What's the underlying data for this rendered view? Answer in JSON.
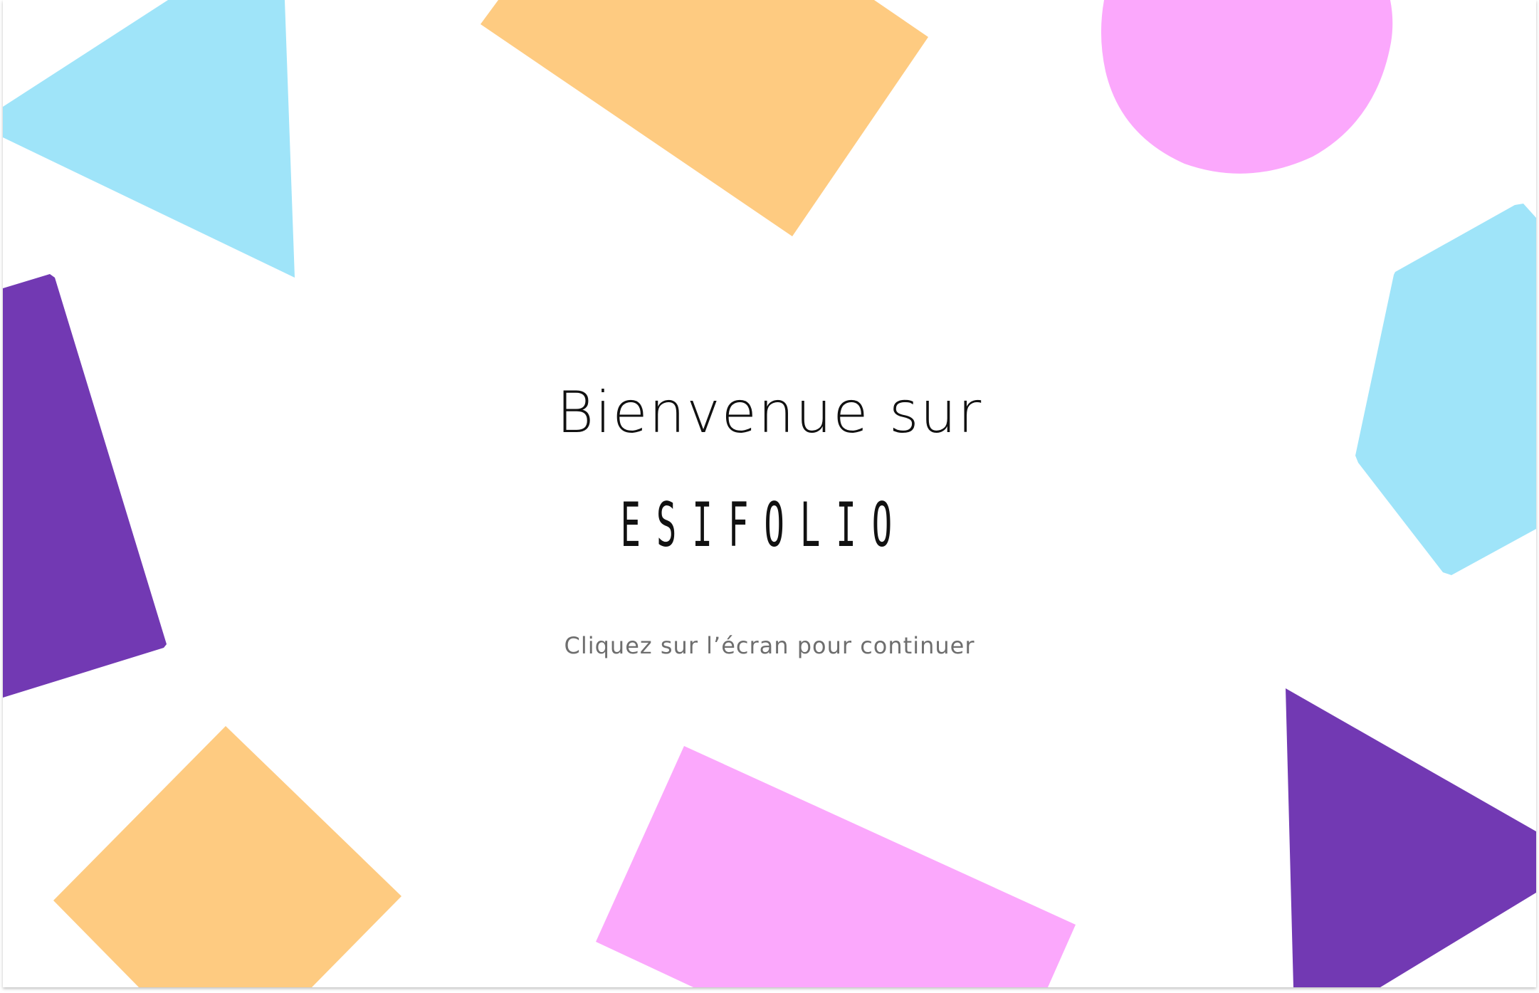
{
  "welcome": {
    "heading": "Bienvenue sur",
    "brand": "ESIFOLIO",
    "hint": "Cliquez sur l’écran pour continuer"
  },
  "colors": {
    "light_blue": "#9fe4f9",
    "orange": "#fecb81",
    "pink": "#fba8fc",
    "purple": "#7239b3",
    "text": "#111111",
    "hint_text": "#6e6e6e"
  }
}
